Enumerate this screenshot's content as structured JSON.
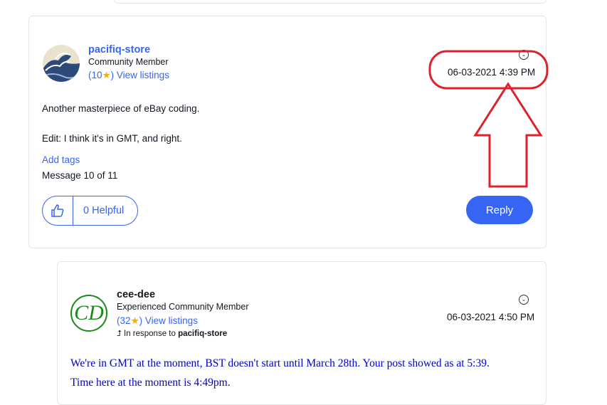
{
  "post": {
    "username": "pacifiq-store",
    "rank": "Community Member",
    "feedback_score": "10",
    "listings_label": "View listings",
    "timestamp_date": "06-03-2021",
    "timestamp_time": "4:39 PM",
    "body_line1": "Another masterpiece of eBay coding.",
    "body_line2": "Edit: I think it's in GMT, and right.",
    "add_tags": "Add tags",
    "message_count": "Message 10 of 11",
    "kudos_count": "0",
    "kudos_label": "Helpful",
    "reply_label": "Reply"
  },
  "reply": {
    "username": "cee-dee",
    "rank": "Experienced Community Member",
    "feedback_score": "32",
    "listings_label": "View listings",
    "avatar_text": "CD",
    "in_response_prefix": "In response to",
    "in_response_user": "pacifiq-store",
    "timestamp_date": "06-03-2021",
    "timestamp_time": "4:50 PM",
    "body_line1": "We're in GMT at the moment, BST doesn't start until March 28th. Your post showed as at 5:39.",
    "body_line2": "Time here at the moment is 4:49pm."
  },
  "colors": {
    "accent": "#3665f3",
    "annotation": "#e0202a",
    "star": "#f5af02",
    "reply_text": "#0000cc"
  },
  "icons": {
    "options": "chevron-circle-icon",
    "kudos": "thumbs-up-icon",
    "in_response": "reply-arrow-icon"
  }
}
